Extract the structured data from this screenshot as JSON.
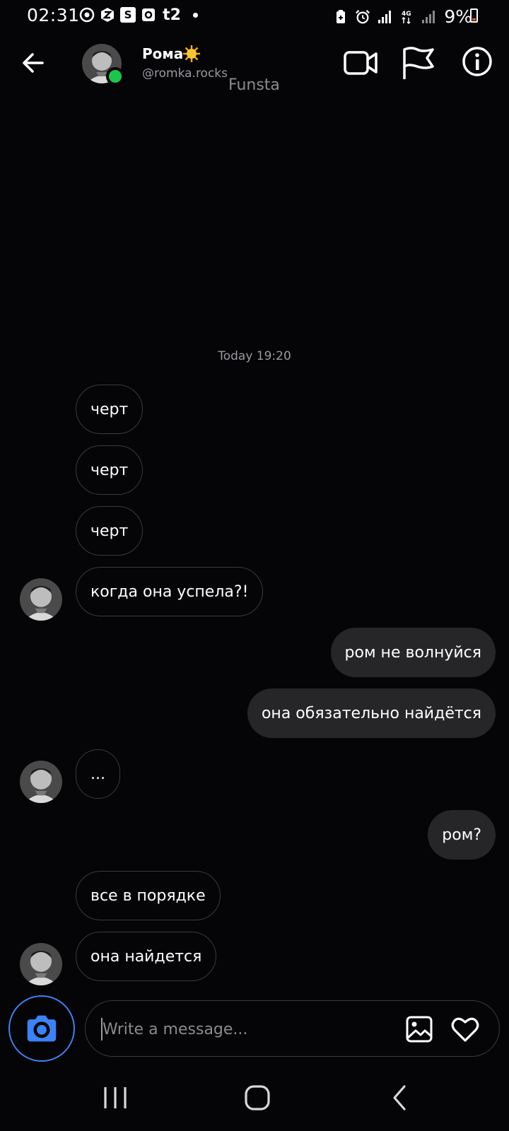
{
  "status_bar": {
    "time": "02:31",
    "battery_percent": "9%",
    "network": "4G",
    "left_icons": [
      "media-icon",
      "z-icon",
      "s-icon",
      "d-icon",
      "t2-icon",
      "dot-icon"
    ],
    "right_icons": [
      "battery-saver-icon",
      "alarm-icon",
      "signal-icon",
      "4g-signal-icon",
      "signal-icon"
    ]
  },
  "header": {
    "contact_name": "Рома",
    "name_emoji": "sun-icon",
    "handle": "@romka.rocks",
    "tag": "Funsta",
    "online": true
  },
  "conversation": {
    "timestamp": "Today 19:20",
    "messages": [
      {
        "from": "them",
        "text": "черт"
      },
      {
        "from": "them",
        "text": "черт"
      },
      {
        "from": "them",
        "text": "черт"
      },
      {
        "from": "them",
        "text": "когда она успела?!"
      },
      {
        "from": "me",
        "text": "ром не волнуйся"
      },
      {
        "from": "me",
        "text": "она обязательно найдётся"
      },
      {
        "from": "them",
        "text": "..."
      },
      {
        "from": "me",
        "text": "ром?"
      },
      {
        "from": "them",
        "text": "все в порядке"
      },
      {
        "from": "them",
        "text": "она найдется"
      }
    ]
  },
  "composer": {
    "placeholder": "Write a message...",
    "value": ""
  },
  "colors": {
    "background": "#050407",
    "outgoing_bubble": "#262629",
    "incoming_border": "#3a3a40",
    "online": "#19c84a",
    "camera_accent": "#3b82f6",
    "muted_text": "#9a9aa0"
  }
}
